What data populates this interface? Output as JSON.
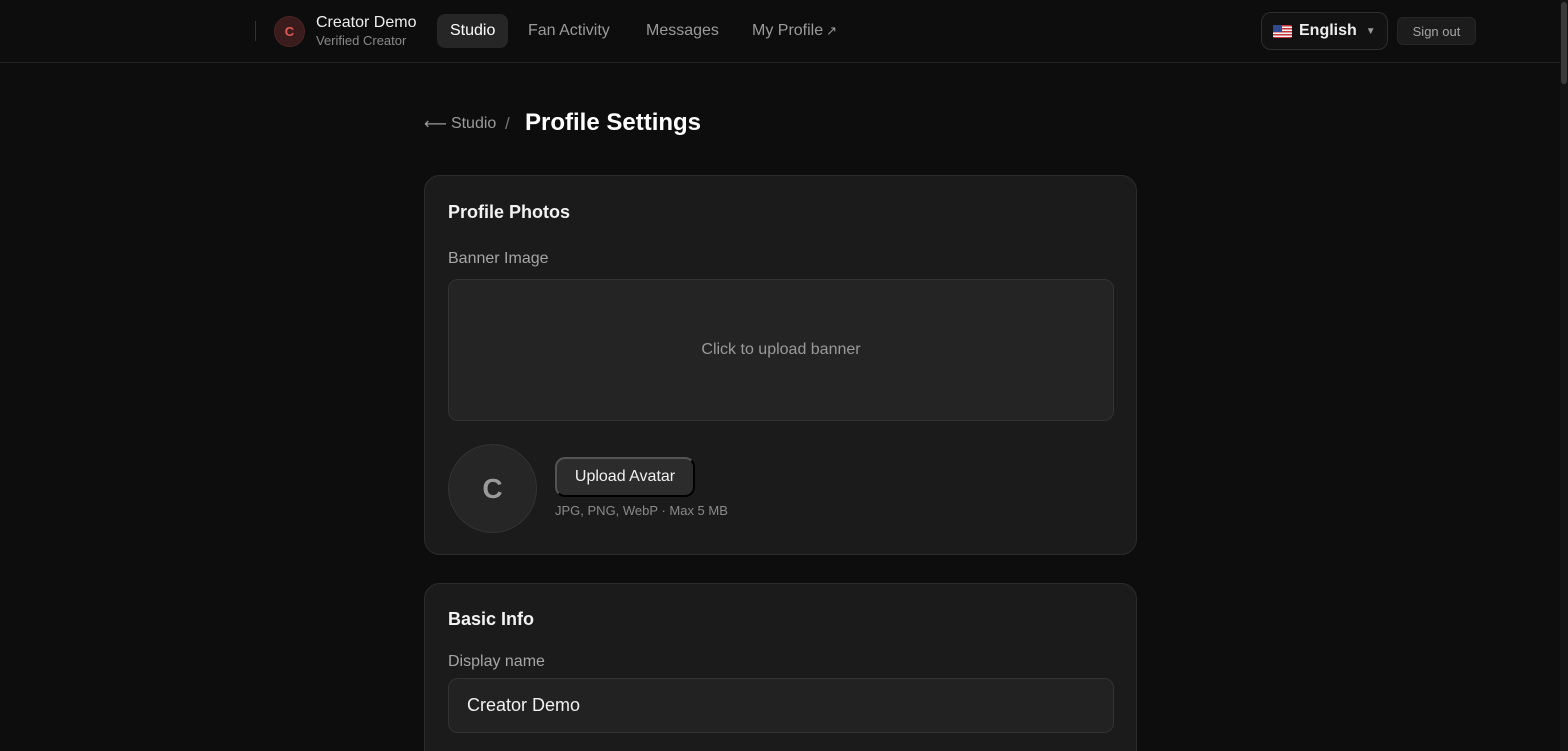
{
  "header": {
    "user": {
      "initial": "C",
      "name": "Creator Demo",
      "subtitle": "Verified Creator"
    },
    "nav": [
      {
        "label": "Studio",
        "active": true
      },
      {
        "label": "Fan Activity",
        "active": false
      },
      {
        "label": "Messages",
        "active": false
      },
      {
        "label": "My Profile",
        "active": false,
        "external_icon": "↗"
      }
    ],
    "language": {
      "flag": "us-flag-icon",
      "label": "English",
      "chevron": "⌄"
    },
    "signout_label": "Sign out"
  },
  "breadcrumb": {
    "back_arrow": "⟵",
    "back_label": "Studio",
    "separator": "/",
    "current": "Profile Settings"
  },
  "photos_card": {
    "title": "Profile Photos",
    "banner_label": "Banner Image",
    "banner_placeholder": "Click to upload banner",
    "avatar_initial": "C",
    "upload_avatar_label": "Upload Avatar",
    "upload_hint": "JPG, PNG, WebP · Max 5 MB"
  },
  "basic_card": {
    "title": "Basic Info",
    "display_name_label": "Display name",
    "display_name_value": "Creator Demo"
  },
  "colors": {
    "background": "#0d0d0d",
    "card": "#1b1b1b",
    "accent_avatar": "#e25a5a"
  }
}
